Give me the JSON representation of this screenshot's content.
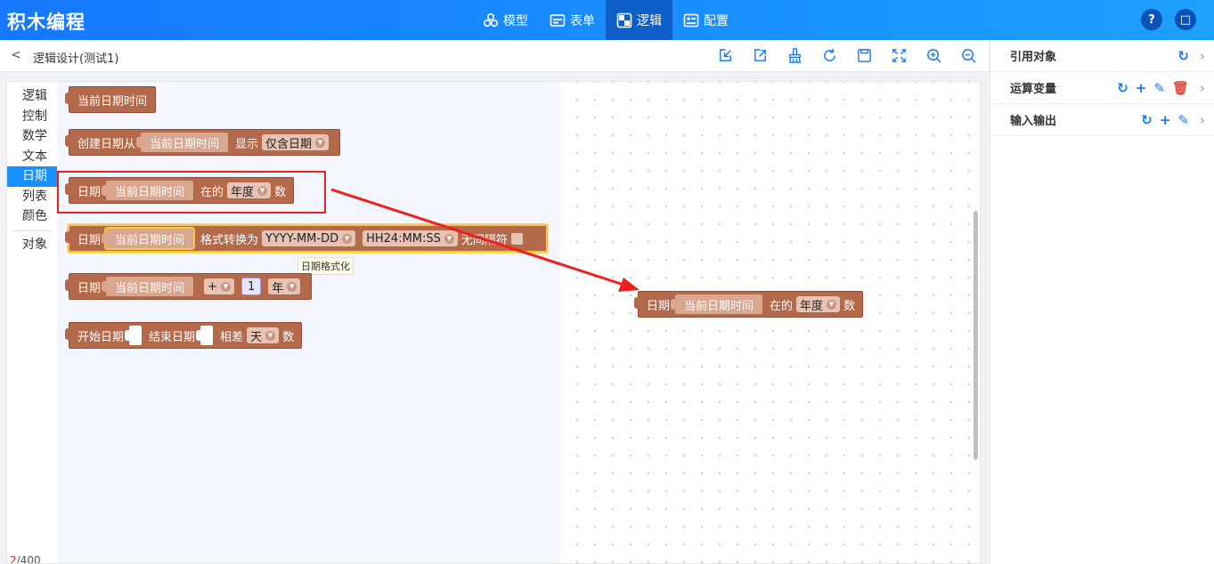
{
  "app": {
    "title": "积木编程"
  },
  "nav": [
    {
      "label": "模型",
      "icon": "model-icon",
      "active": false
    },
    {
      "label": "表单",
      "icon": "form-icon",
      "active": false
    },
    {
      "label": "逻辑",
      "icon": "logic-icon",
      "active": true
    },
    {
      "label": "配置",
      "icon": "config-icon",
      "active": false
    }
  ],
  "header_right": {
    "help": "?",
    "window": "□"
  },
  "subbar": {
    "back": "<",
    "title": "逻辑设计(测试1)",
    "tools": [
      "import-icon",
      "export-icon",
      "clean-icon",
      "refresh-icon",
      "save-icon",
      "fit-icon",
      "zoom-in-icon",
      "zoom-out-icon"
    ]
  },
  "toolbox": [
    "逻辑",
    "控制",
    "数学",
    "文本",
    "日期",
    "列表",
    "颜色",
    "对象"
  ],
  "toolbox_selected": "日期",
  "blocks": {
    "b1": {
      "label": "当前日期时间"
    },
    "b2": {
      "label": "创建日期从",
      "slot": "当前日期时间",
      "show": "显示",
      "dd": "仅含日期"
    },
    "b3": {
      "label": "日期",
      "slot": "当前日期时间",
      "at": "在的",
      "dd": "年度",
      "tail": "数"
    },
    "b4": {
      "label": "日期",
      "slot": "当前日期时间",
      "fmt": "格式转换为",
      "dd1": "YYYY-MM-DD",
      "dd2": "HH24:MM:SS",
      "tail": "无间隔符"
    },
    "b5": {
      "label": "日期",
      "slot": "当前日期时间",
      "op": "+",
      "num": "1",
      "unit": "年"
    },
    "b6": {
      "start": "开始日期",
      "end": "结束日期",
      "diff": "相差",
      "dd": "天",
      "tail": "数"
    },
    "canvas": {
      "label": "日期",
      "slot": "当前日期时间",
      "at": "在的",
      "dd": "年度",
      "tail": "数"
    }
  },
  "tooltip": "日期格式化",
  "counter": {
    "current": "2",
    "total": "/400"
  },
  "right_panel": [
    {
      "label": "引用对象"
    },
    {
      "label": "运算变量"
    },
    {
      "label": "输入输出"
    }
  ],
  "colors": {
    "header": "#1890ff",
    "block": "#b5694b",
    "highlight": "#ef2020",
    "arrow": "#ef2020"
  }
}
